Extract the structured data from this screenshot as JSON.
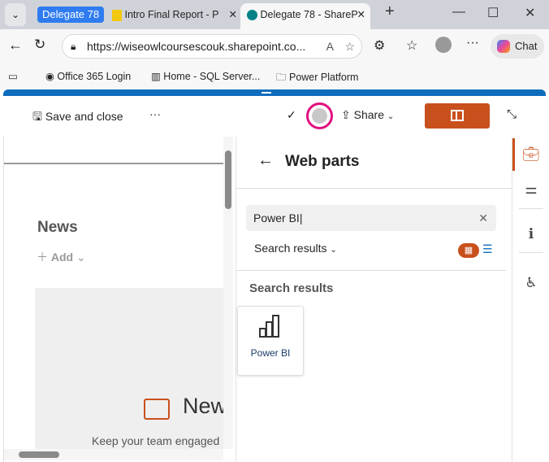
{
  "browser": {
    "tab_group": "Delegate 78",
    "tabs": [
      {
        "label": "Intro Final Report - P"
      },
      {
        "label": "Delegate 78 - ShareP"
      }
    ],
    "url": "https://wiseowlcoursescouk.sharepoint.co...",
    "chat_label": "Chat",
    "bookmarks": [
      {
        "label": "Office 365 Login"
      },
      {
        "label": "Home - SQL Server..."
      },
      {
        "label": "Power Platform"
      }
    ]
  },
  "command_bar": {
    "save_label": "Save and close",
    "more": "···",
    "share_label": "Share"
  },
  "canvas": {
    "news_heading": "News",
    "add_label": "Add",
    "placeholder_title": "New",
    "placeholder_text": "Keep your team engaged"
  },
  "panel": {
    "title": "Web parts",
    "search_value": "Power BI",
    "filter_label": "Search results",
    "section_title": "Search results",
    "results": [
      {
        "label": "Power BI"
      }
    ]
  },
  "colors": {
    "accent": "#c8501c",
    "blue": "#0f6cbd"
  }
}
